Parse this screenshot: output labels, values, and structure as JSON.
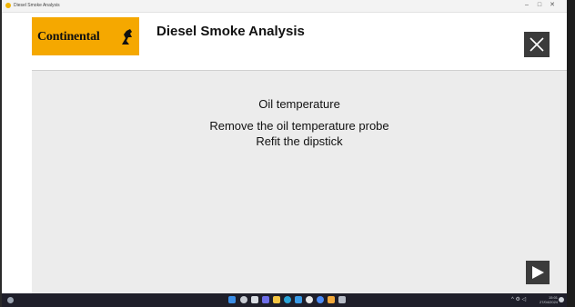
{
  "window": {
    "title": "Diesel Smoke Analysis",
    "controls": {
      "minimize": "–",
      "maximize": "□",
      "close": "✕"
    }
  },
  "header": {
    "logo_text": "Continental",
    "logo_mark_icon": "horse-icon",
    "title": "Diesel Smoke Analysis",
    "close_icon": "close-icon"
  },
  "content": {
    "lines": [
      "Oil temperature",
      "Remove the oil temperature probe",
      "Refit the dipstick"
    ]
  },
  "footer": {
    "next_icon": "play-icon"
  },
  "taskbar": {
    "tray_symbols": "^ ⚙ ◁",
    "clock_time": "15:01",
    "clock_date": "27/04/2024"
  },
  "colors": {
    "brand": "#f5a800",
    "button": "#3b3b3b",
    "content_bg": "#ececec",
    "taskbar": "#1f1f2a"
  }
}
